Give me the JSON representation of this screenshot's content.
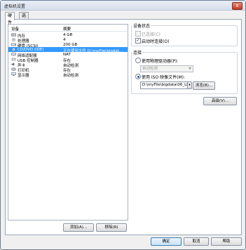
{
  "window": {
    "title": "虚拟机设置",
    "close_glyph": "x"
  },
  "tabs": [
    {
      "label": "硬件"
    },
    {
      "label": "选项"
    }
  ],
  "device_list": {
    "col_device": "设备",
    "col_summary": "摘要",
    "rows": [
      {
        "name": "内存",
        "summary": "4 GB",
        "icon": "memory-icon"
      },
      {
        "name": "处理器",
        "summary": "4",
        "icon": "processor-icon"
      },
      {
        "name": "硬盘 (SCSI)",
        "summary": "200 GB",
        "icon": "harddisk-icon"
      },
      {
        "name": "CD/DVD (IDE)",
        "summary": "正在使用文件 D:\\myFile\\bigdat...",
        "icon": "cd-dvd-icon"
      },
      {
        "name": "网络适配器",
        "summary": "NAT",
        "icon": "network-adapter-icon"
      },
      {
        "name": "USB 控制器",
        "summary": "存在",
        "icon": "usb-icon"
      },
      {
        "name": "声卡",
        "summary": "自动检测",
        "icon": "sound-card-icon"
      },
      {
        "name": "打印机",
        "summary": "存在",
        "icon": "printer-icon"
      },
      {
        "name": "显示器",
        "summary": "自动检测",
        "icon": "monitor-icon"
      }
    ],
    "selected_index": 3
  },
  "buttons": {
    "add": "添加(A)...",
    "remove": "移除(R)",
    "ok": "确定",
    "cancel": "取消",
    "help": "帮助",
    "advanced": "高级(V)...",
    "browse": "浏览(B)..."
  },
  "device_status": {
    "title": "设备状态",
    "connected": {
      "label": "已连接(C)",
      "checked": false,
      "disabled": true
    },
    "connect_on_power": {
      "label": "启动时连接(O)",
      "checked": true
    }
  },
  "connection": {
    "title": "连接",
    "physical_drive": {
      "label": "使用物理驱动器(P):",
      "selected": false
    },
    "physical_drive_value": "自动检测",
    "iso": {
      "label": "使用 ISO 映像文件(M):",
      "selected": true
    },
    "iso_path": "D:\\myFile\\bigdata\\06_Linux\\"
  },
  "colors": {
    "selection": "#3399ff",
    "accent": "#3c7fb1"
  }
}
